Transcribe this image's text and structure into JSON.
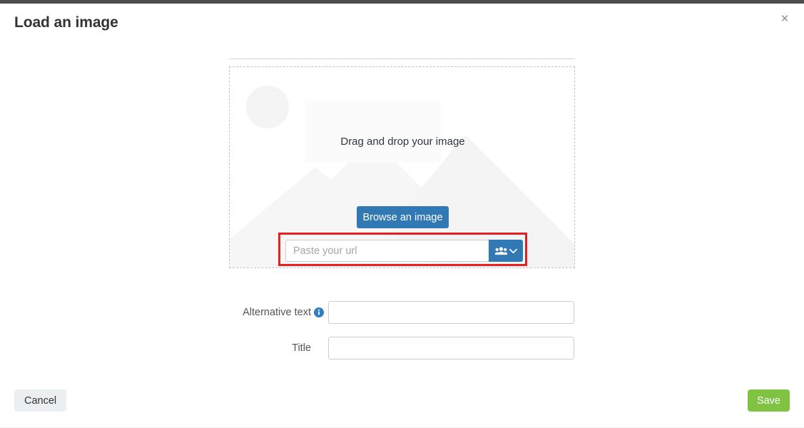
{
  "window": {
    "title": "Load an image",
    "close_label": "×"
  },
  "dropzone": {
    "drag_text": "Drag and drop your image",
    "browse_label": "Browse an image",
    "url_placeholder": "Paste your url",
    "url_value": "",
    "addon_icon": "users-icon",
    "addon_chevron_icon": "chevron-down-icon",
    "watermark_icon": "image-placeholder-landscape-icon",
    "highlight_color": "#e52121"
  },
  "fields": [
    {
      "label": "Alternative text",
      "value": "",
      "placeholder": "",
      "has_info_icon": true,
      "info_icon": "info-circle-icon"
    },
    {
      "label": "Title",
      "value": "",
      "placeholder": "",
      "has_info_icon": false,
      "info_icon": ""
    }
  ],
  "footer": {
    "cancel_label": "Cancel",
    "save_label": "Save"
  },
  "colors": {
    "primary_blue": "#3079b5",
    "save_green": "#80c342",
    "highlight_red": "#e52121",
    "topbar_dark": "#4d4d4d"
  }
}
